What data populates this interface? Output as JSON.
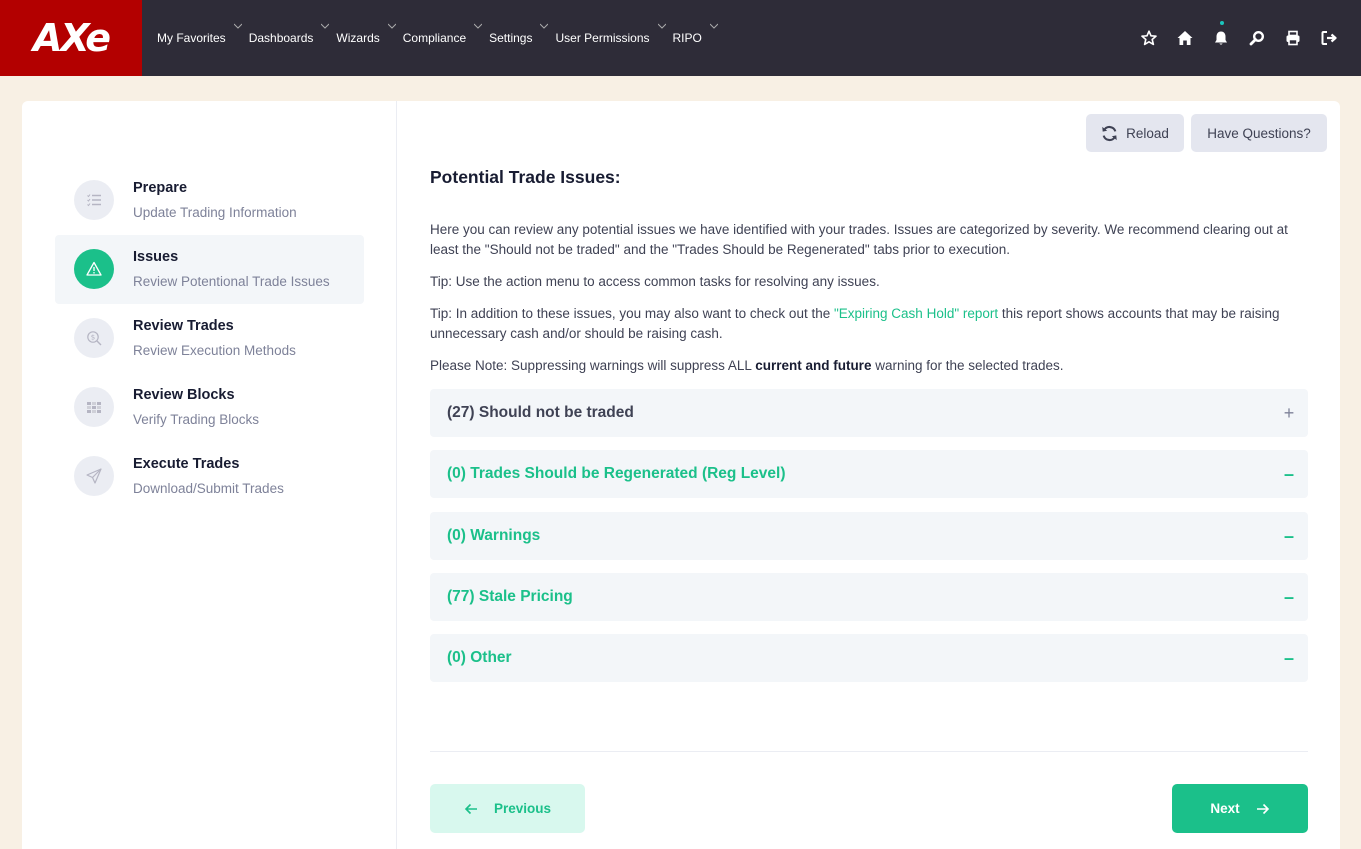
{
  "brand": {
    "logo_text": "AXe"
  },
  "nav": {
    "items": [
      {
        "label": "My Favorites"
      },
      {
        "label": "Dashboards"
      },
      {
        "label": "Wizards"
      },
      {
        "label": "Compliance"
      },
      {
        "label": "Settings"
      },
      {
        "label": "User Permissions"
      },
      {
        "label": "RIPO"
      }
    ],
    "right_icons": [
      "star-icon",
      "home-icon",
      "bell-icon",
      "search-icon",
      "print-icon",
      "logout-icon"
    ]
  },
  "steps": [
    {
      "title": "Prepare",
      "subtitle": "Update Trading Information",
      "icon": "checklist-icon",
      "active": false
    },
    {
      "title": "Issues",
      "subtitle": "Review Potentional Trade Issues",
      "icon": "warning-icon",
      "active": true
    },
    {
      "title": "Review Trades",
      "subtitle": "Review Execution Methods",
      "icon": "money-search-icon",
      "active": false
    },
    {
      "title": "Review Blocks",
      "subtitle": "Verify Trading Blocks",
      "icon": "blocks-icon",
      "active": false
    },
    {
      "title": "Execute Trades",
      "subtitle": "Download/Submit Trades",
      "icon": "send-icon",
      "active": false
    }
  ],
  "toolbar": {
    "reload_label": "Reload",
    "questions_label": "Have Questions?"
  },
  "content": {
    "title": "Potential Trade Issues:",
    "intro": "Here you can review any potential issues we have identified with your trades. Issues are categorized by severity. We recommend clearing out at least the \"Should not be traded\" and the \"Trades Should be Regenerated\" tabs prior to execution.",
    "tip1": "Tip: Use the action menu to access common tasks for resolving any issues.",
    "tip2_before": "Tip: In addition to these issues, you may also want to check out the ",
    "tip2_link": "\"Expiring Cash Hold\" report",
    "tip2_after": " this report shows accounts that may be raising unnecessary cash and/or should be raising cash.",
    "note_before": "Please Note: Suppressing warnings will suppress ALL ",
    "note_bold": "current and future",
    "note_after": " warning for the selected trades."
  },
  "accordions": [
    {
      "label": "(27) Should not be traded",
      "toggle": "+",
      "style": "gray"
    },
    {
      "label": "(0) Trades Should be Regenerated (Reg Level)",
      "toggle": "–",
      "style": "green"
    },
    {
      "label": "(0) Warnings",
      "toggle": "–",
      "style": "green"
    },
    {
      "label": "(77) Stale Pricing",
      "toggle": "–",
      "style": "green"
    },
    {
      "label": "(0) Other",
      "toggle": "–",
      "style": "green"
    }
  ],
  "footer": {
    "previous_label": "Previous",
    "next_label": "Next"
  },
  "colors": {
    "accent": "#1bc08a",
    "brand": "#b30000",
    "topbar": "#2e2c38",
    "page_bg": "#f8f0e4"
  }
}
